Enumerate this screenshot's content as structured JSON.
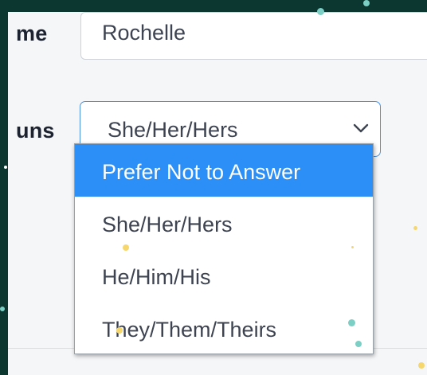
{
  "form": {
    "name_label": "me",
    "name_value": "Rochelle",
    "pronouns_label": "uns",
    "pronouns_value": "She/Her/Hers"
  },
  "dropdown": {
    "options": [
      {
        "label": "Prefer Not to Answer",
        "selected": true
      },
      {
        "label": "She/Her/Hers",
        "selected": false
      },
      {
        "label": "He/Him/His",
        "selected": false
      },
      {
        "label": "They/Them/Theirs",
        "selected": false
      }
    ]
  },
  "colors": {
    "background": "#0c3630",
    "highlight": "#2b8ff7",
    "focus_border": "#4a90e2",
    "confetti_teal": "#7ccfc4",
    "confetti_yellow": "#f5d76e"
  },
  "icons": {
    "select_arrow": "chevron-down-icon"
  }
}
